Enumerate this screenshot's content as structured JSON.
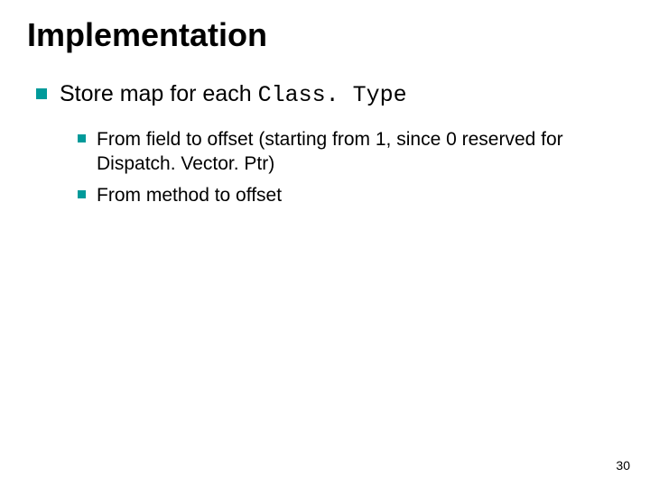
{
  "title": "Implementation",
  "bullets": {
    "b1_prefix": "Store map for each ",
    "b1_code": "Class. Type",
    "b2": "From field to offset (starting from 1, since 0 reserved for Dispatch. Vector. Ptr)",
    "b3": "From method to offset"
  },
  "page_number": "30"
}
